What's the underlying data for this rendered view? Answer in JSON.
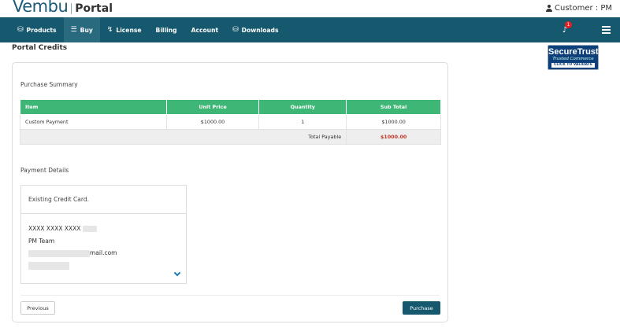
{
  "brand": {
    "logo_text": "Vembu",
    "product": "Portal"
  },
  "customer": {
    "label": "Customer : PM"
  },
  "nav": {
    "items": [
      {
        "label": "Products",
        "icon": "⛁",
        "icon_name": "products-icon"
      },
      {
        "label": "Buy",
        "icon": "🛒",
        "icon_name": "cart-icon",
        "active": true
      },
      {
        "label": "License",
        "icon": "⚿",
        "icon_name": "key-icon"
      },
      {
        "label": "Billing"
      },
      {
        "label": "Account"
      },
      {
        "label": "Downloads",
        "icon": "⛁",
        "icon_name": "downloads-icon"
      }
    ],
    "notifications_count": "1"
  },
  "page": {
    "title": "Portal Credits"
  },
  "badge": {
    "title": "SecureTrust",
    "subtitle": "Trusted Commerce",
    "cta": "CLICK TO VALIDATE"
  },
  "summary": {
    "heading": "Purchase Summary",
    "columns": [
      "Item",
      "Unit Price",
      "Quantity",
      "Sub Total"
    ],
    "rows": [
      {
        "item": "Custom Payment",
        "unit_price": "$1000.00",
        "quantity": "1",
        "sub_total": "$1000.00"
      }
    ],
    "total_label": "Total Payable",
    "total_value": "$1000.00"
  },
  "payment": {
    "heading": "Payment Details",
    "option_label": "Existing Credit Card.",
    "card_number": "XXXX XXXX XXXX",
    "name": "PM Team",
    "email_suffix": "mail.com"
  },
  "actions": {
    "previous": "Previous",
    "purchase": "Purchase"
  },
  "colors": {
    "navbar": "#16596f",
    "table_header": "#3eb675",
    "total": "#c0392b"
  }
}
